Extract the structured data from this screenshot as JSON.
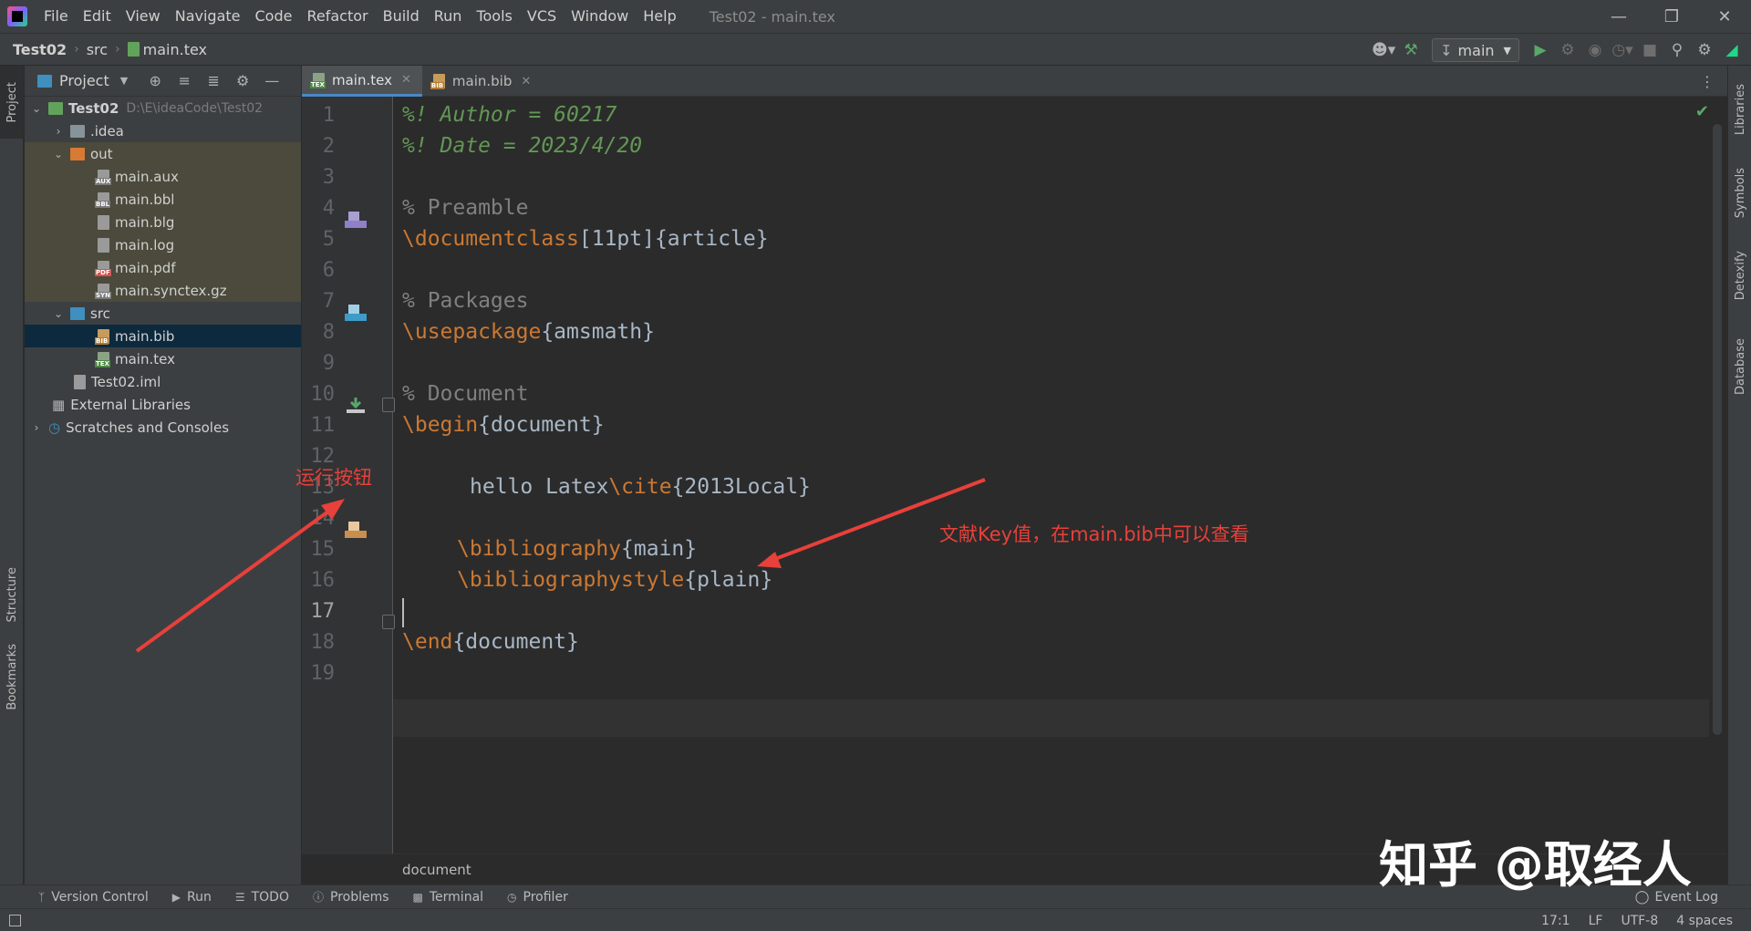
{
  "window": {
    "title": "Test02 - main.tex",
    "menu": [
      "File",
      "Edit",
      "View",
      "Navigate",
      "Code",
      "Refactor",
      "Build",
      "Run",
      "Tools",
      "VCS",
      "Window",
      "Help"
    ]
  },
  "navbar": {
    "breadcrumbs": [
      "Test02",
      "src",
      "main.tex"
    ],
    "run_config": "main"
  },
  "left_strip": {
    "project": "Project",
    "structure": "Structure",
    "bookmarks": "Bookmarks"
  },
  "right_strip": {
    "libraries": "Libraries",
    "symbols": "Symbols",
    "detexify": "Detexify",
    "database": "Database"
  },
  "project_panel": {
    "title": "Project",
    "root": {
      "name": "Test02",
      "path": "D:\\E\\ideaCode\\Test02"
    },
    "idea": ".idea",
    "out": "out",
    "out_files": [
      "main.aux",
      "main.bbl",
      "main.blg",
      "main.log",
      "main.pdf",
      "main.synctex.gz"
    ],
    "out_tags": [
      "AUX",
      "BBL",
      "",
      "",
      "PDF",
      "SYN"
    ],
    "src": "src",
    "src_files": [
      "main.bib",
      "main.tex"
    ],
    "src_tags": [
      "BIB",
      "TEX"
    ],
    "iml": "Test02.iml",
    "external": "External Libraries",
    "scratches": "Scratches and Consoles"
  },
  "tabs": [
    {
      "label": "main.tex",
      "tag": "TEX"
    },
    {
      "label": "main.bib",
      "tag": "BIB"
    }
  ],
  "editor": {
    "line_numbers": [
      "1",
      "2",
      "3",
      "4",
      "5",
      "6",
      "7",
      "8",
      "9",
      "10",
      "11",
      "12",
      "13",
      "14",
      "15",
      "16",
      "17",
      "18",
      "19"
    ],
    "code": {
      "l1": "%! Author = 60217",
      "l2": "%! Date = 2023/4/20",
      "l4": "% Preamble",
      "l5_cmd": "\\documentclass",
      "l5_rest": "[11pt]{article}",
      "l7": "% Packages",
      "l8_cmd": "\\usepackage",
      "l8_rest": "{amsmath}",
      "l10": "% Document",
      "l11_cmd": "\\begin",
      "l11_rest": "{document}",
      "l13_text": "hello Latex",
      "l13_cmd": "\\cite",
      "l13_rest": "{2013Local}",
      "l15_cmd": "\\bibliography",
      "l15_rest": "{main}",
      "l16_cmd": "\\bibliographystyle",
      "l16_rest": "{plain}",
      "l18_cmd": "\\end",
      "l18_rest": "{document}"
    },
    "breadcrumb": "document"
  },
  "bottom_tools": [
    "Version Control",
    "Run",
    "TODO",
    "Problems",
    "Terminal",
    "Profiler"
  ],
  "event_log": "Event Log",
  "status": {
    "position": "17:1",
    "line_sep": "LF",
    "encoding": "UTF-8",
    "indent": "4 spaces"
  },
  "annotations": {
    "run_button": "运行按钮",
    "cite_key": "文献Key值，在main.bib中可以查看",
    "watermark": "知乎 @取经人"
  },
  "colors": {
    "keyword": "#cc7832",
    "comment": "#808080",
    "magic_comment": "#629755",
    "annotation": "#e8403a",
    "selection": "#0d293e"
  }
}
